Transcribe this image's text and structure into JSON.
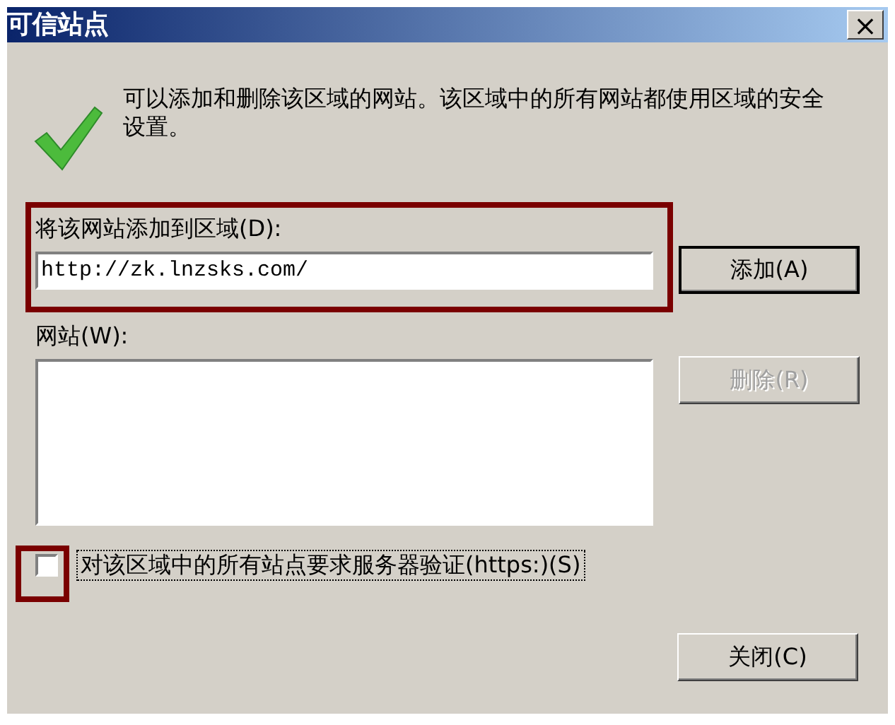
{
  "window": {
    "title": "可信站点",
    "close_button": "×"
  },
  "description": "可以添加和删除该区域的网站。该区域中的所有网站都使用区域的安全设置。",
  "add_field": {
    "label": "将该网站添加到区域(D):",
    "value": "http://zk.lnzsks.com/"
  },
  "add_button": {
    "label": "添加(A)",
    "disabled": false
  },
  "sites": {
    "label": "网站(W):"
  },
  "remove_button": {
    "label": "删除(R)",
    "disabled": true
  },
  "require_https": {
    "label": "对该区域中的所有站点要求服务器验证(https:)(S)",
    "checked": false,
    "focused": true
  },
  "buttons": [
    {
      "label": "关闭(C)",
      "disabled": false
    }
  ]
}
